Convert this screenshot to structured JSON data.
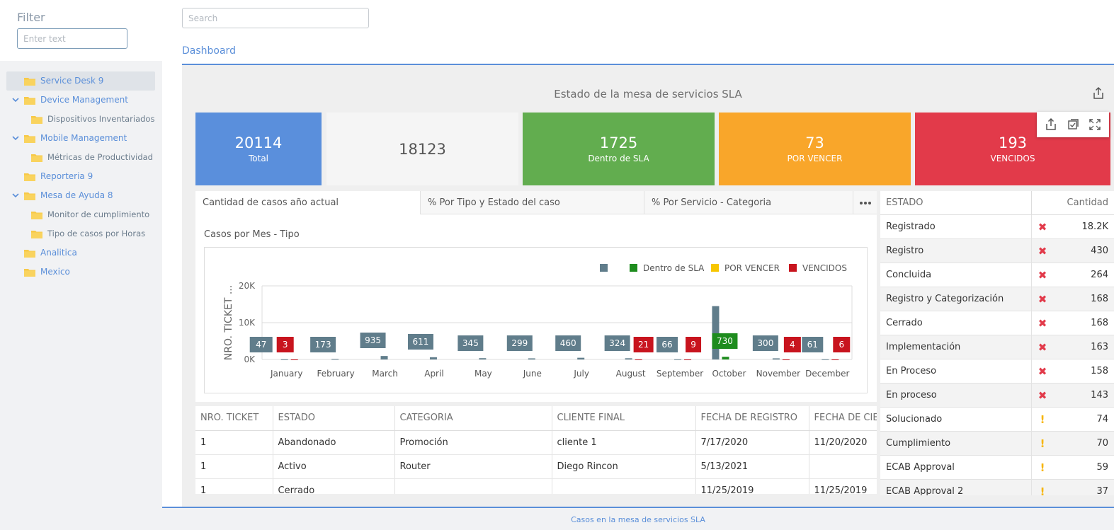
{
  "sidebar": {
    "filter_title": "Filter",
    "filter_placeholder": "Enter text",
    "tree": [
      {
        "label": "Service Desk 9",
        "level": 0,
        "expanded": false,
        "selected": true
      },
      {
        "label": "Device Management",
        "level": 0,
        "expanded": true,
        "selected": false
      },
      {
        "label": "Dispositivos Inventariados",
        "level": 1,
        "selected": false
      },
      {
        "label": "Mobile Management",
        "level": 0,
        "expanded": true,
        "selected": false
      },
      {
        "label": "Métricas de Productividad",
        "level": 1,
        "selected": false
      },
      {
        "label": "Reporteria 9",
        "level": 0,
        "expanded": false,
        "selected": false
      },
      {
        "label": "Mesa de Ayuda 8",
        "level": 0,
        "expanded": true,
        "selected": false
      },
      {
        "label": "Monitor de cumplimiento",
        "level": 1,
        "selected": false
      },
      {
        "label": "Tipo de casos por Horas",
        "level": 1,
        "selected": false
      },
      {
        "label": "Analitica",
        "level": 0,
        "expanded": false,
        "selected": false
      },
      {
        "label": "Mexico",
        "level": 0,
        "expanded": false,
        "selected": false
      }
    ]
  },
  "header": {
    "search_placeholder": "Search",
    "tab_label": "Dashboard"
  },
  "dashboard": {
    "title": "Estado de la mesa de servicios SLA",
    "cards": {
      "total": {
        "value": "20114",
        "label": "Total",
        "color": "#5a8fdc"
      },
      "plain": {
        "value": "18123",
        "color": "#f5f5f5"
      },
      "dentro": {
        "value": "1725",
        "label": "Dentro de SLA",
        "color": "#62ad4f"
      },
      "por_vencer": {
        "value": "73",
        "label": "POR VENCER",
        "color": "#f9a62a"
      },
      "vencidos": {
        "value": "193",
        "label": "VENCIDOS",
        "color": "#e23a4a"
      }
    },
    "card_toolbar_icons": [
      "export-icon",
      "multiselect-icon",
      "fullscreen-icon"
    ],
    "tabs": [
      "Cantidad de casos año actual",
      "% Por Tipo y Estado del caso",
      "% Por Servicio - Categoria"
    ],
    "chart_title": "Casos por Mes - Tipo"
  },
  "chart_data": {
    "type": "bar",
    "title": "",
    "xlabel": "",
    "ylabel": "NRO. TICKET ...",
    "ylim": [
      0,
      20000
    ],
    "yticks": [
      "0K",
      "10K",
      "20K"
    ],
    "grid": true,
    "legend_position": "top-right",
    "categories": [
      "January",
      "February",
      "March",
      "April",
      "May",
      "June",
      "July",
      "August",
      "September",
      "October",
      "November",
      "December"
    ],
    "series": [
      {
        "name": "",
        "color": "#607d8b",
        "values": [
          47,
          173,
          935,
          611,
          345,
          299,
          460,
          324,
          66,
          14500,
          300,
          61
        ],
        "labels": [
          "47",
          "173",
          "935",
          "611",
          "345",
          "299",
          "460",
          "324",
          "66",
          "",
          "300",
          "61"
        ]
      },
      {
        "name": "Dentro de SLA",
        "color": "#1e8c1e",
        "values": [
          null,
          null,
          null,
          null,
          null,
          null,
          null,
          null,
          null,
          730,
          null,
          null
        ],
        "labels": [
          "",
          "",
          "",
          "",
          "",
          "",
          "",
          "",
          "",
          "730",
          "",
          ""
        ]
      },
      {
        "name": "POR VENCER",
        "color": "#f7c600",
        "values": [
          null,
          null,
          null,
          null,
          null,
          null,
          null,
          null,
          null,
          null,
          null,
          null
        ],
        "labels": []
      },
      {
        "name": "VENCIDOS",
        "color": "#c8141e",
        "values": [
          3,
          null,
          null,
          null,
          null,
          null,
          null,
          21,
          9,
          null,
          4,
          6
        ],
        "labels": [
          "3",
          "",
          "",
          "",
          "",
          "",
          "",
          "21",
          "9",
          "",
          "4",
          "6"
        ]
      }
    ]
  },
  "status_table": {
    "header_estado": "ESTADO",
    "header_cantidad": "Cantidad",
    "rows": [
      {
        "estado": "Registrado",
        "icon": "red-x-icon",
        "cantidad": "18.2K"
      },
      {
        "estado": "Registro",
        "icon": "red-x-icon",
        "cantidad": "430"
      },
      {
        "estado": "Concluida",
        "icon": "red-x-icon",
        "cantidad": "264"
      },
      {
        "estado": "Registro y Categorización",
        "icon": "red-x-icon",
        "cantidad": "168"
      },
      {
        "estado": "Cerrado",
        "icon": "red-x-icon",
        "cantidad": "168"
      },
      {
        "estado": "Implementación",
        "icon": "red-x-icon",
        "cantidad": "163"
      },
      {
        "estado": "En Proceso",
        "icon": "red-x-icon",
        "cantidad": "158"
      },
      {
        "estado": "En proceso",
        "icon": "red-x-icon",
        "cantidad": "143"
      },
      {
        "estado": "Solucionado",
        "icon": "amber-exclamation-icon",
        "cantidad": "74"
      },
      {
        "estado": "Cumplimiento",
        "icon": "amber-exclamation-icon",
        "cantidad": "70"
      },
      {
        "estado": "ECAB Approval",
        "icon": "amber-exclamation-icon",
        "cantidad": "59"
      },
      {
        "estado": "ECAB Approval 2",
        "icon": "amber-exclamation-icon",
        "cantidad": "37"
      }
    ]
  },
  "tickets_table": {
    "columns": [
      "NRO. TICKET",
      "ESTADO",
      "CATEGORIA",
      "CLIENTE FINAL",
      "FECHA DE REGISTRO",
      "FECHA DE CIERRE"
    ],
    "rows": [
      [
        "1",
        "Abandonado",
        "Promoción",
        "cliente 1",
        "7/17/2020",
        "11/20/2020"
      ],
      [
        "1",
        "Activo",
        "Router",
        "Diego Rincon",
        "5/13/2021",
        ""
      ],
      [
        "1",
        "Cerrado",
        "",
        "",
        "11/25/2019",
        "11/25/2019"
      ]
    ]
  },
  "footer": {
    "label": "Casos en la mesa de servicios SLA"
  }
}
